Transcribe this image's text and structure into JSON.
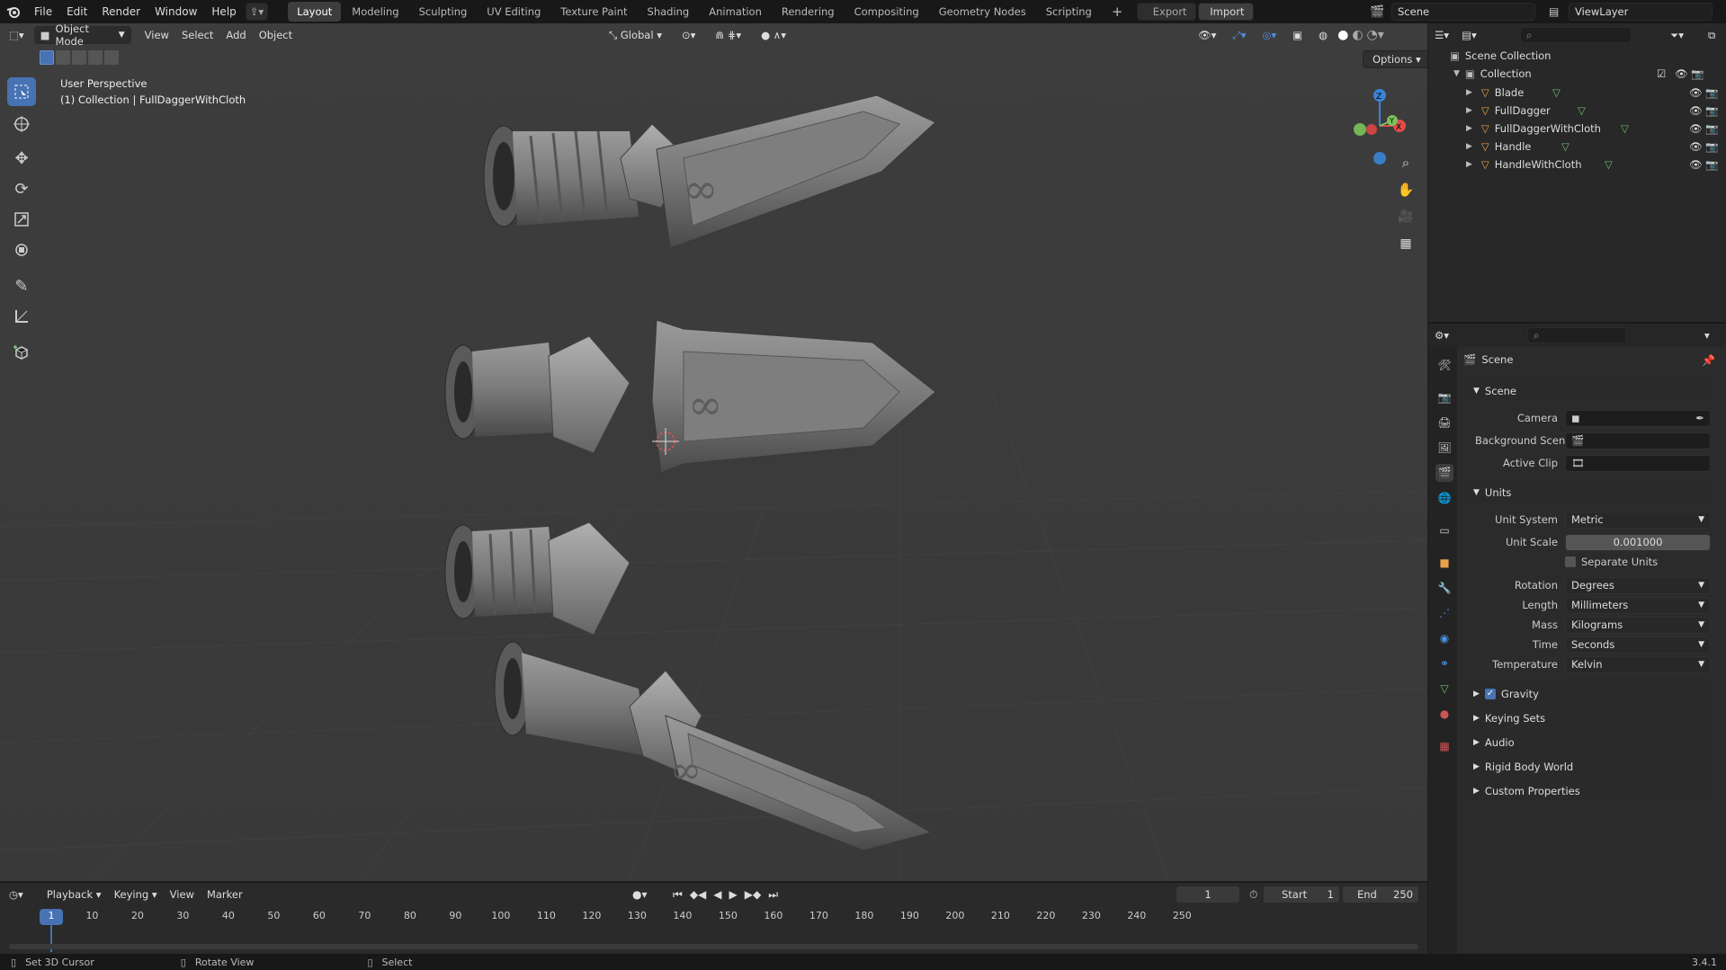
{
  "topbar": {
    "menus": [
      "File",
      "Edit",
      "Render",
      "Window",
      "Help"
    ],
    "workspaces": [
      "Layout",
      "Modeling",
      "Sculpting",
      "UV Editing",
      "Texture Paint",
      "Shading",
      "Animation",
      "Rendering",
      "Compositing",
      "Geometry Nodes",
      "Scripting"
    ],
    "active_workspace": "Layout",
    "export_label": "Export",
    "import_label": "Import",
    "scene_name": "Scene",
    "viewlayer_name": "ViewLayer"
  },
  "viewport_header": {
    "mode": "Object Mode",
    "menus": [
      "View",
      "Select",
      "Add",
      "Object"
    ],
    "orientation": "Global",
    "options_label": "Options"
  },
  "viewport": {
    "perspective": "User Perspective",
    "collection_info": "(1) Collection | FullDaggerWithCloth"
  },
  "outliner": {
    "root": "Scene Collection",
    "collection": "Collection",
    "items": [
      "Blade",
      "FullDagger",
      "FullDaggerWithCloth",
      "Handle",
      "HandleWithCloth"
    ]
  },
  "properties": {
    "context": "Scene",
    "scene_section": "Scene",
    "camera_label": "Camera",
    "background_scene_label": "Background Scene",
    "active_clip_label": "Active Clip",
    "units_section": "Units",
    "unit_system_label": "Unit System",
    "unit_system": "Metric",
    "unit_scale_label": "Unit Scale",
    "unit_scale": "0.001000",
    "separate_units": "Separate Units",
    "rotation_label": "Rotation",
    "rotation": "Degrees",
    "length_label": "Length",
    "length": "Millimeters",
    "mass_label": "Mass",
    "mass": "Kilograms",
    "time_label": "Time",
    "time": "Seconds",
    "temperature_label": "Temperature",
    "temperature": "Kelvin",
    "gravity": "Gravity",
    "collapsed": [
      "Keying Sets",
      "Audio",
      "Rigid Body World",
      "Custom Properties"
    ]
  },
  "timeline": {
    "menus": [
      "Playback",
      "Keying",
      "View",
      "Marker"
    ],
    "current_frame": "1",
    "start_label": "Start",
    "start": "1",
    "end_label": "End",
    "end": "250",
    "ticks": [
      "1",
      "10",
      "20",
      "30",
      "40",
      "50",
      "60",
      "70",
      "80",
      "90",
      "100",
      "110",
      "120",
      "130",
      "140",
      "150",
      "160",
      "170",
      "180",
      "190",
      "200",
      "210",
      "220",
      "230",
      "240",
      "250"
    ]
  },
  "statusbar": {
    "hint1": "Set 3D Cursor",
    "hint2": "Rotate View",
    "hint3": "Select",
    "version": "3.4.1"
  },
  "colors": {
    "accent": "#4772b3",
    "object_orange": "#e8a04d",
    "mesh_green": "#6dbb6d",
    "axis_x": "#e04a4a",
    "axis_y": "#7ac25a",
    "axis_z": "#3a84d6"
  }
}
